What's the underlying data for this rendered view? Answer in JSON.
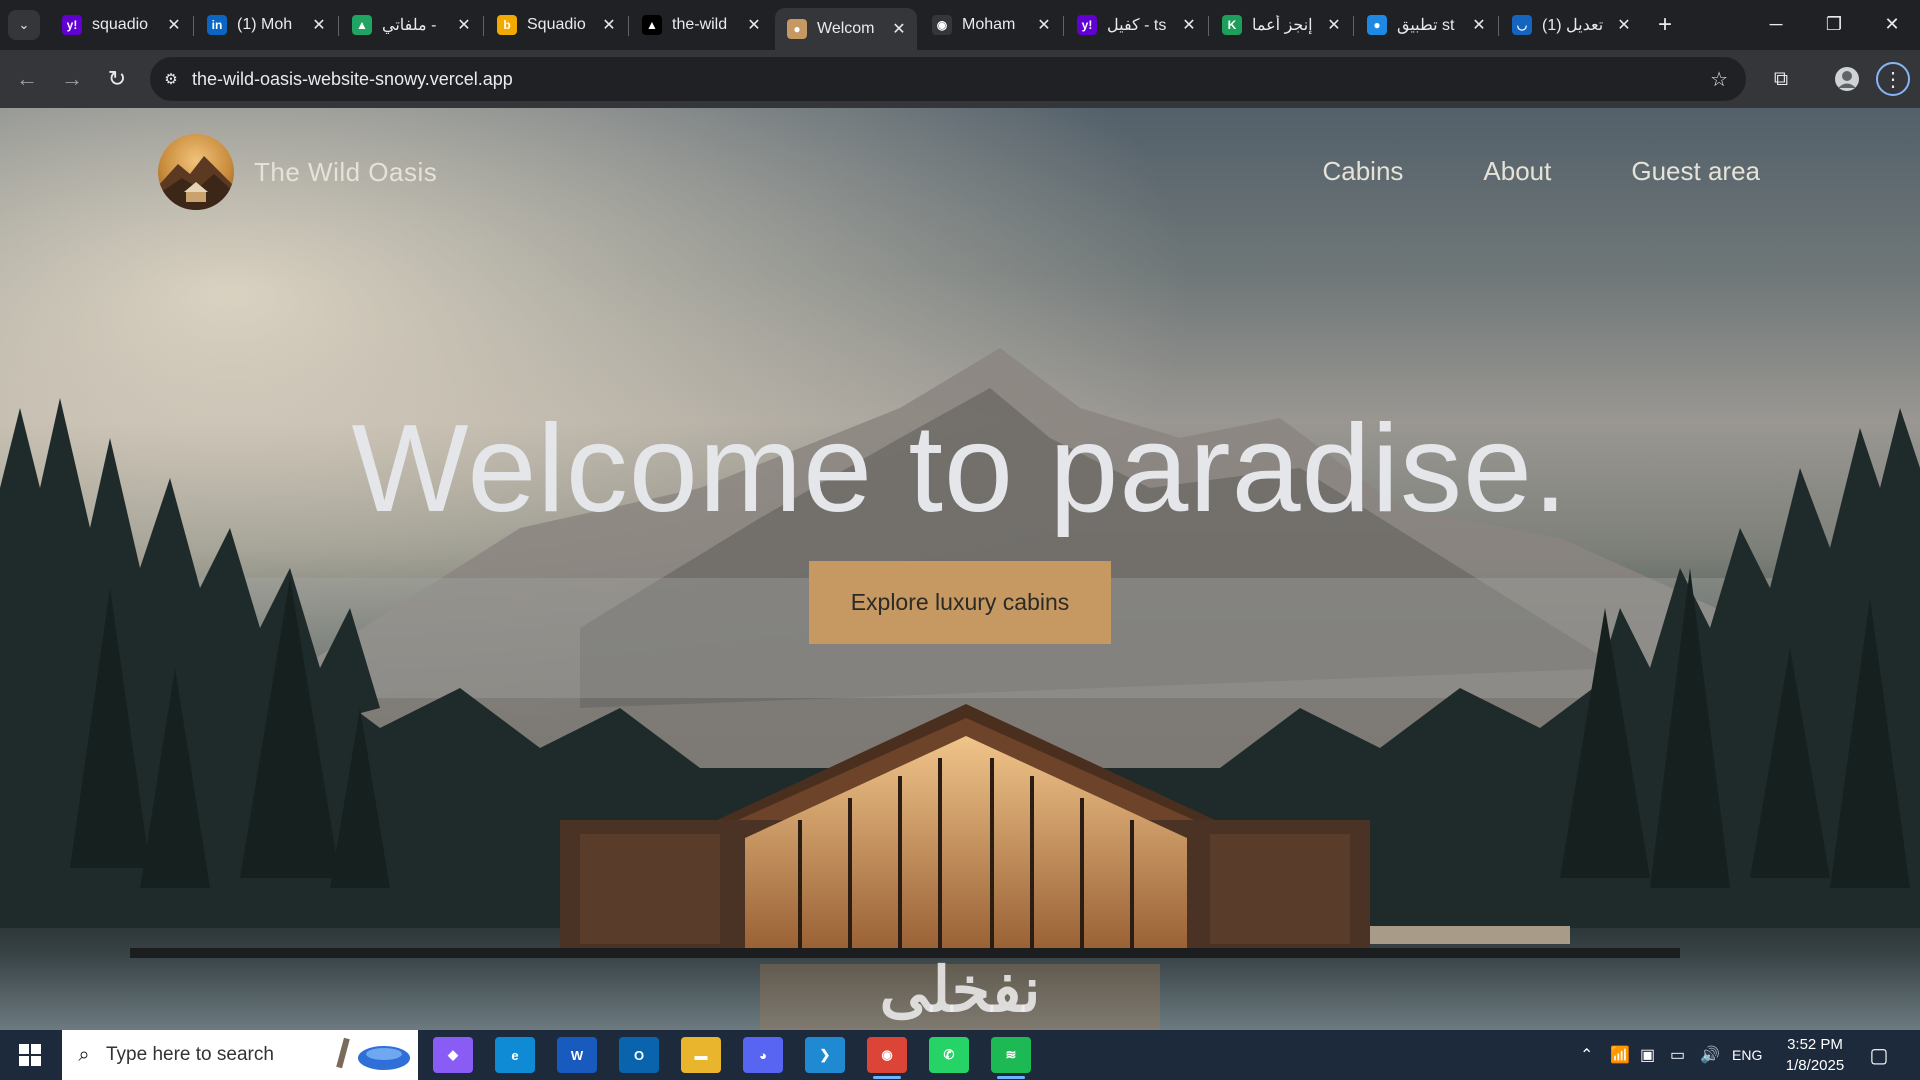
{
  "browser": {
    "tabs": [
      {
        "label": "squadio",
        "favicon_color": "#6001d2",
        "favicon_glyph": "y!",
        "icon": "yahoo-icon",
        "active": false
      },
      {
        "label": "(1) Moh",
        "favicon_color": "#0a66c2",
        "favicon_glyph": "in",
        "icon": "linkedin-icon",
        "active": false
      },
      {
        "label": "ملفاتي -",
        "favicon_color": "#1fa463",
        "favicon_glyph": "▲",
        "icon": "google-drive-icon",
        "active": false
      },
      {
        "label": "Squadio",
        "favicon_color": "#f2a900",
        "favicon_glyph": "b",
        "icon": "bayt-icon",
        "active": false
      },
      {
        "label": "the-wild",
        "favicon_color": "#000000",
        "favicon_glyph": "▲",
        "icon": "vercel-icon",
        "active": false
      },
      {
        "label": "Welcom",
        "favicon_color": "#c69963",
        "favicon_glyph": "●",
        "icon": "wild-oasis-icon",
        "active": true
      },
      {
        "label": "Moham",
        "favicon_color": "#35363a",
        "favicon_glyph": "◉",
        "icon": "github-icon",
        "active": false
      },
      {
        "label": "كفيل - ts",
        "favicon_color": "#6001d2",
        "favicon_glyph": "y!",
        "icon": "yahoo-icon",
        "active": false
      },
      {
        "label": "إنجز أعما",
        "favicon_color": "#1d9e5a",
        "favicon_glyph": "K",
        "icon": "kafiil-icon",
        "active": false
      },
      {
        "label": "تطبيق st",
        "favicon_color": "#1e88e5",
        "favicon_glyph": "●",
        "icon": "app-icon",
        "active": false
      },
      {
        "label": "(1) تعديل",
        "favicon_color": "#1565c0",
        "favicon_glyph": "◡",
        "icon": "mostaql-icon",
        "active": false
      }
    ],
    "url": "the-wild-oasis-website-snowy.vercel.app"
  },
  "site": {
    "brand": "The Wild Oasis",
    "nav": [
      "Cabins",
      "About",
      "Guest area"
    ],
    "hero_title": "Welcome to paradise.",
    "cta": "Explore luxury cabins",
    "watermark": "نفخلى",
    "accent": "#c69963"
  },
  "taskbar": {
    "search_placeholder": "Type here to search",
    "apps": [
      {
        "name": "copilot-icon",
        "color": "#8a5cf6",
        "glyph": "◆"
      },
      {
        "name": "edge-icon",
        "color": "#0f8bd6",
        "glyph": "e"
      },
      {
        "name": "word-icon",
        "color": "#185abd",
        "glyph": "W"
      },
      {
        "name": "outlook-icon",
        "color": "#0a64ad",
        "glyph": "O"
      },
      {
        "name": "file-explorer-icon",
        "color": "#e8b52c",
        "glyph": "▬"
      },
      {
        "name": "discord-icon",
        "color": "#5865f2",
        "glyph": "◕"
      },
      {
        "name": "vscode-icon",
        "color": "#1f8ad2",
        "glyph": "❯"
      },
      {
        "name": "chrome-icon",
        "color": "#db4437",
        "glyph": "◉"
      },
      {
        "name": "whatsapp-icon",
        "color": "#25d366",
        "glyph": "✆"
      },
      {
        "name": "spotify-icon",
        "color": "#1db954",
        "glyph": "≋"
      }
    ],
    "lang": "ENG",
    "time": "3:52 PM",
    "date": "1/8/2025"
  }
}
